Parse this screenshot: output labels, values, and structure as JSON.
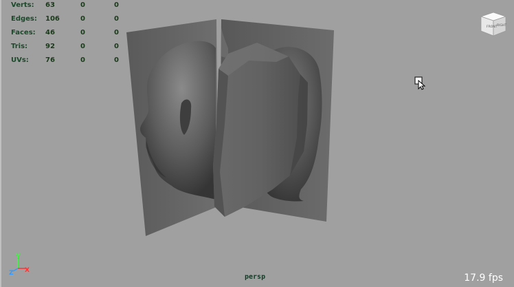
{
  "hud": {
    "rows": [
      {
        "label": "Verts:",
        "v1": "63",
        "v2": "0",
        "v3": "0"
      },
      {
        "label": "Edges:",
        "v1": "106",
        "v2": "0",
        "v3": "0"
      },
      {
        "label": "Faces:",
        "v1": "46",
        "v2": "0",
        "v3": "0"
      },
      {
        "label": "Tris:",
        "v1": "92",
        "v2": "0",
        "v3": "0"
      },
      {
        "label": "UVs:",
        "v1": "76",
        "v2": "0",
        "v3": "0"
      }
    ]
  },
  "viewport": {
    "camera": "persp",
    "fps": "17.9 fps",
    "viewcube_front": "FRONT",
    "viewcube_right": "RIGHT"
  },
  "axis": {
    "y": "Y",
    "z": "Z",
    "x": "X",
    "y_color": "#33ff33",
    "z_color": "#3399ff",
    "x_color": "#ff3333"
  },
  "icons": {
    "cursor": "pointer-with-box-icon",
    "viewcube": "viewcube-icon",
    "axis": "axis-gizmo-icon"
  }
}
